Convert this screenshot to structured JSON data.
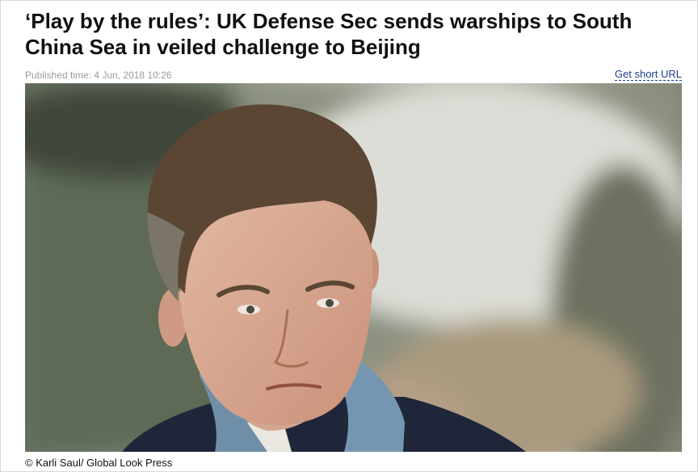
{
  "article": {
    "headline": "‘Play by the rules’: UK Defense Sec sends warships to South China Sea in veiled challenge to Beijing",
    "published": "Published time: 4 Jun, 2018 10:26",
    "short_url_label": "Get short URL",
    "photo_alt": "Man in navy coat and blue scarf outdoors",
    "photo_credit": "© Karli Saul/ Global Look Press"
  }
}
